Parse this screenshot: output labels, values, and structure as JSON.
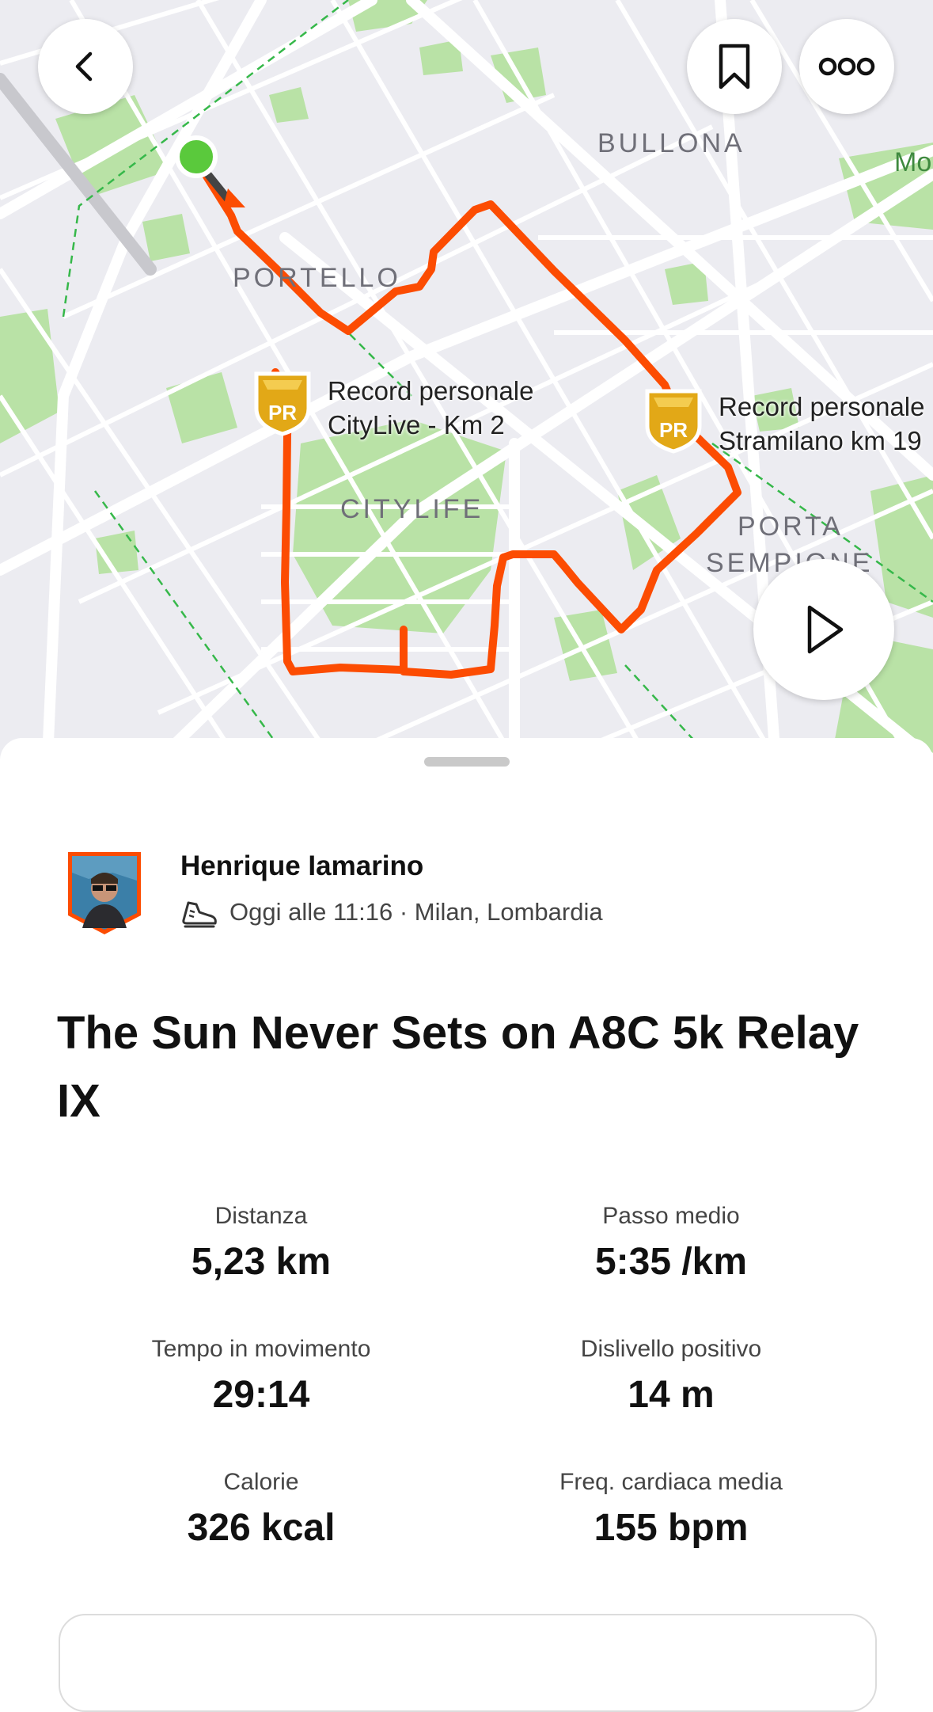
{
  "map": {
    "labels": {
      "bullona": "BULLONA",
      "mo": "Mo",
      "portello": "PORTELLO",
      "citylife": "CITYLIFE",
      "porta": "PORTA",
      "sempione": "SEMPIONE"
    },
    "pr_markers": [
      {
        "badge": "PR",
        "line1": "Record personale",
        "line2": "CityLive - Km 2"
      },
      {
        "badge": "PR",
        "line1": "Record personale",
        "line2": "Stramilano km 19"
      }
    ],
    "colors": {
      "route": "#fc4c02",
      "start": "#5ac93c",
      "map_bg": "#ececf1",
      "park": "#b9e2a6"
    }
  },
  "toolbar": {
    "back_icon": "chevron-left-icon",
    "bookmark_icon": "bookmark-icon",
    "more_icon": "more-dots-icon",
    "play_icon": "play-icon"
  },
  "activity": {
    "athlete_name": "Henrique Iamarino",
    "meta": "Oggi alle 11:16 · Milan, Lombardia",
    "sport_icon": "running-shoe-icon",
    "title": "The Sun Never Sets on A8C 5k Relay IX"
  },
  "stats": [
    {
      "label": "Distanza",
      "value": "5,23 km"
    },
    {
      "label": "Passo medio",
      "value": "5:35 /km"
    },
    {
      "label": "Tempo in movimento",
      "value": "29:14"
    },
    {
      "label": "Dislivello positivo",
      "value": "14 m"
    },
    {
      "label": "Calorie",
      "value": "326 kcal"
    },
    {
      "label": "Freq. cardiaca media",
      "value": "155 bpm"
    }
  ]
}
